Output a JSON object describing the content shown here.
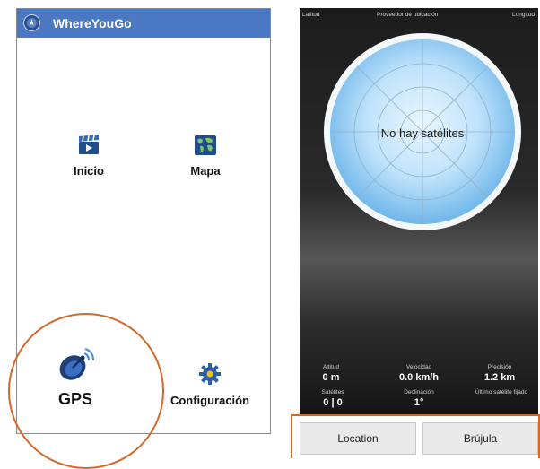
{
  "left_app": {
    "title": "WhereYouGo",
    "tiles": [
      {
        "label": "Inicio",
        "icon": "clapperboard-icon"
      },
      {
        "label": "Mapa",
        "icon": "world-map-icon"
      },
      {
        "label": "GPS",
        "icon": "satellite-dish-icon"
      },
      {
        "label": "Configuración",
        "icon": "gear-icon"
      }
    ]
  },
  "gps_screen": {
    "header": {
      "latitude": "Latitud",
      "provider": "Proveedor de ubicación",
      "longitude": "Longitud"
    },
    "radar_message": "No hay satélites",
    "stats": [
      {
        "label": "Altitud",
        "value": "0 m"
      },
      {
        "label": "Velocidad",
        "value": "0.0 km/h"
      },
      {
        "label": "Precisión",
        "value": "1.2 km"
      },
      {
        "label": "Satélites",
        "value": "0 | 0"
      },
      {
        "label": "Declinación",
        "value": "1°"
      },
      {
        "label": "Último satélite fijado",
        "value": ""
      }
    ],
    "buttons": {
      "location": "Location",
      "compass": "Brújula"
    }
  },
  "colors": {
    "app_bar": "#4a78c2",
    "highlight": "#d2692c",
    "radar": "#a8d8f8"
  }
}
